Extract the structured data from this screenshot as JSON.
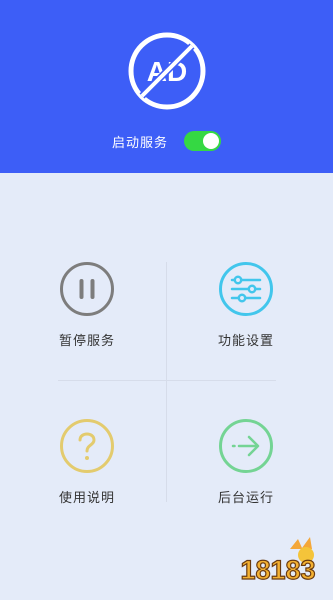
{
  "header": {
    "logo_text": "AD",
    "service_label": "启动服务",
    "service_enabled": true
  },
  "menu": {
    "items": [
      {
        "label": "暂停服务",
        "icon": "pause-icon",
        "color": "#7d7d7d"
      },
      {
        "label": "功能设置",
        "icon": "sliders-icon",
        "color": "#42c6ec"
      },
      {
        "label": "使用说明",
        "icon": "question-icon",
        "color": "#e3cb6e"
      },
      {
        "label": "后台运行",
        "icon": "arrow-right-icon",
        "color": "#74d494"
      }
    ]
  },
  "watermark": {
    "text": "18183"
  },
  "colors": {
    "header_bg": "#3d5ef7",
    "page_bg": "#e4ebf9",
    "toggle_on": "#35d843"
  }
}
